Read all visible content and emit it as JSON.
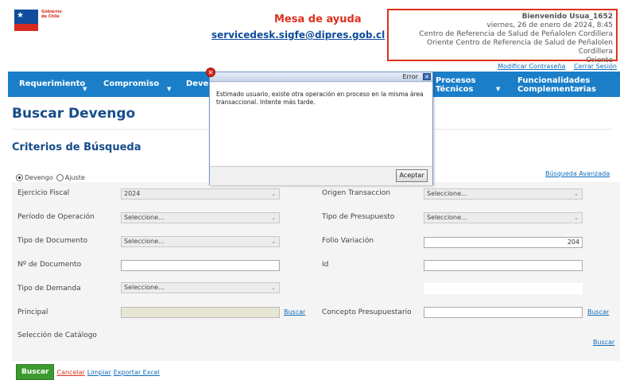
{
  "header": {
    "logo_text_line1": "Gobierno",
    "logo_text_line2": "de Chile",
    "helpdesk_title": "Mesa de ayuda",
    "helpdesk_email": "servicedesk.sigfe@dipres.gob.cl"
  },
  "user": {
    "welcome": "Bienvenido Usua_1652",
    "datetime": "viernes, 26 de enero de 2024, 8:45",
    "line1": "Centro de Referencia de Salud de Peñalolen Cordillera",
    "line2": "Oriente Centro de Referencia de Salud de Peñalolen Cordillera",
    "line3": "Oriente"
  },
  "toplinks": {
    "change_password": "Modificar Contraseña",
    "logout": "Cerrar Sesión"
  },
  "nav": {
    "requerimiento": "Requerimiento",
    "compromiso": "Compromiso",
    "devengo": "Deven",
    "procesos_line1": "Procesos",
    "procesos_line2": "Técnicos",
    "funcionalidades_line1": "Funcionalidades",
    "funcionalidades_line2": "Complementarias"
  },
  "page": {
    "title": "Buscar Devengo",
    "section_title": "Criterios de Búsqueda",
    "radio_devengo": "Devengo",
    "radio_ajuste": "Ajuste",
    "advanced_search": "Búsqueda Avanzada"
  },
  "form": {
    "ejercicio_label": "Ejercicio Fiscal",
    "ejercicio_value": "2024",
    "origen_label": "Origen Transaccion",
    "origen_value": "Seleccione...",
    "periodo_label": "Período de Operación",
    "periodo_value": "Seleccione...",
    "tipo_presupuesto_label": "Tipo de Presupuesto",
    "tipo_presupuesto_value": "Seleccione...",
    "tipo_documento_label": "Tipo de Documento",
    "tipo_documento_value": "Seleccione...",
    "folio_label": "Folio Variación",
    "folio_value": "204",
    "nro_documento_label": "Nº de Documento",
    "nro_documento_value": "",
    "id_label": "Id",
    "id_value": "",
    "tipo_demanda_label": "Tipo de Demanda",
    "tipo_demanda_value": "Seleccione...",
    "principal_label": "Principal",
    "principal_value": "",
    "principal_buscar": "Buscar",
    "concepto_label": "Concepto Presupuestario",
    "concepto_value": "",
    "concepto_buscar": "Buscar",
    "catalogo_label": "Selección de Catálogo",
    "catalogo_buscar": "Buscar"
  },
  "actions": {
    "buscar": "Buscar",
    "cancelar": "Cancelar",
    "limpiar": "Limpiar",
    "exportar": "Exportar Excel"
  },
  "dialog": {
    "title": "Error",
    "message": "Estimado usuario, existe otra operación en proceso en la misma área transaccional. Intente más tarde.",
    "ok": "Aceptar"
  }
}
